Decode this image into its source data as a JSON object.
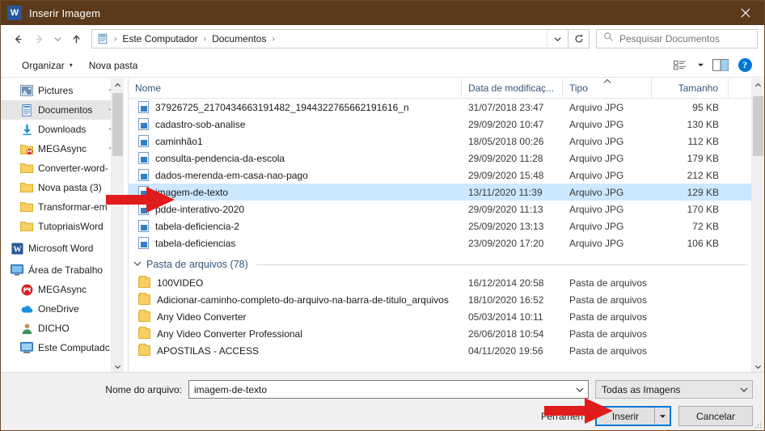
{
  "window": {
    "title": "Inserir Imagem",
    "app_icon": "word-icon",
    "close_label": "✕",
    "accent_brown": "#5b3a1c",
    "accent_blue": "#0078d7"
  },
  "addressbar": {
    "back_icon": "back-arrow-icon",
    "forward_icon": "forward-arrow-icon",
    "recent_icon": "chevron-down-icon",
    "up_icon": "up-arrow-icon",
    "crumb_icon": "documents-icon",
    "crumbs": [
      "Este Computador",
      "Documentos"
    ],
    "separator": "›",
    "dropdown_icon": "chevron-down-icon",
    "refresh_icon": "refresh-icon",
    "search_icon": "search-icon",
    "search_placeholder": "Pesquisar Documentos"
  },
  "commandbar": {
    "organize_label": "Organizar",
    "organize_caret": "▾",
    "new_folder_label": "Nova pasta",
    "view_icon": "view-layout-icon",
    "view_caret": "▾",
    "preview_icon": "preview-pane-icon",
    "help_icon": "help-icon",
    "help_label": "?"
  },
  "navpane": {
    "items": [
      {
        "label": "Pictures",
        "icon": "pictures-icon",
        "pinned": true,
        "selected": false,
        "indent": "child"
      },
      {
        "label": "Documentos",
        "icon": "documents-icon",
        "pinned": true,
        "selected": true,
        "indent": "child"
      },
      {
        "label": "Downloads",
        "icon": "downloads-icon",
        "pinned": true,
        "selected": false,
        "indent": "child"
      },
      {
        "label": "MEGAsync",
        "icon": "megasync-folder-icon",
        "pinned": true,
        "selected": false,
        "indent": "child"
      },
      {
        "label": "Converter-word-",
        "icon": "folder-icon",
        "pinned": false,
        "selected": false,
        "indent": "child"
      },
      {
        "label": "Nova pasta (3)",
        "icon": "folder-icon",
        "pinned": false,
        "selected": false,
        "indent": "child"
      },
      {
        "label": "Transformar-em",
        "icon": "folder-icon",
        "pinned": false,
        "selected": false,
        "indent": "child"
      },
      {
        "label": "TutopriaisWord",
        "icon": "folder-icon",
        "pinned": false,
        "selected": false,
        "indent": "child"
      }
    ],
    "items2": [
      {
        "label": "Microsoft Word",
        "icon": "word-icon",
        "pinned": false,
        "selected": false,
        "indent": "root"
      }
    ],
    "items3": [
      {
        "label": "Área de Trabalho",
        "icon": "desktop-icon",
        "pinned": false,
        "selected": false,
        "indent": "root"
      },
      {
        "label": "MEGAsync",
        "icon": "megasync-icon",
        "pinned": false,
        "selected": false,
        "indent": "child"
      },
      {
        "label": "OneDrive",
        "icon": "onedrive-icon",
        "pinned": false,
        "selected": false,
        "indent": "child"
      },
      {
        "label": "DICHO",
        "icon": "user-icon",
        "pinned": false,
        "selected": false,
        "indent": "child"
      },
      {
        "label": "Este Computadc",
        "icon": "this-pc-icon",
        "pinned": false,
        "selected": false,
        "indent": "child"
      }
    ]
  },
  "filelist": {
    "columns": [
      {
        "key": "nome",
        "label": "Nome"
      },
      {
        "key": "data",
        "label": "Data de modificaç..."
      },
      {
        "key": "tipo",
        "label": "Tipo",
        "sorted": true
      },
      {
        "key": "tam",
        "label": "Tamanho"
      }
    ],
    "files": [
      {
        "nome": "37926725_2170434663191482_1944322765662191616_n",
        "data": "31/07/2018 23:47",
        "tipo": "Arquivo JPG",
        "tam": "95 KB",
        "icon": "jpg-file-icon",
        "selected": false
      },
      {
        "nome": "cadastro-sob-analise",
        "data": "29/09/2020 10:47",
        "tipo": "Arquivo JPG",
        "tam": "130 KB",
        "icon": "jpg-file-icon",
        "selected": false
      },
      {
        "nome": "caminhão1",
        "data": "18/05/2018 00:26",
        "tipo": "Arquivo JPG",
        "tam": "112 KB",
        "icon": "jpg-file-icon",
        "selected": false
      },
      {
        "nome": "consulta-pendencia-da-escola",
        "data": "29/09/2020 11:28",
        "tipo": "Arquivo JPG",
        "tam": "179 KB",
        "icon": "jpg-file-icon",
        "selected": false
      },
      {
        "nome": "dados-merenda-em-casa-nao-pago",
        "data": "29/09/2020 15:48",
        "tipo": "Arquivo JPG",
        "tam": "212 KB",
        "icon": "jpg-file-icon",
        "selected": false
      },
      {
        "nome": "imagem-de-texto",
        "data": "13/11/2020 11:39",
        "tipo": "Arquivo JPG",
        "tam": "129 KB",
        "icon": "jpg-file-icon",
        "selected": true
      },
      {
        "nome": "pdde-interativo-2020",
        "data": "29/09/2020 11:13",
        "tipo": "Arquivo JPG",
        "tam": "170 KB",
        "icon": "jpg-file-icon",
        "selected": false
      },
      {
        "nome": "tabela-deficiencia-2",
        "data": "25/09/2020 13:13",
        "tipo": "Arquivo JPG",
        "tam": "72 KB",
        "icon": "jpg-file-icon",
        "selected": false
      },
      {
        "nome": "tabela-deficiencias",
        "data": "23/09/2020 17:20",
        "tipo": "Arquivo JPG",
        "tam": "106 KB",
        "icon": "jpg-file-icon",
        "selected": false
      }
    ],
    "group": {
      "caret": "˅",
      "label": "Pasta de arquivos (78)"
    },
    "folders": [
      {
        "nome": "100VIDEO",
        "data": "16/12/2014 20:58",
        "tipo": "Pasta de arquivos",
        "tam": "",
        "icon": "folder-icon",
        "selected": false
      },
      {
        "nome": "Adicionar-caminho-completo-do-arquivo-na-barra-de-titulo_arquivos",
        "data": "18/10/2020 16:52",
        "tipo": "Pasta de arquivos",
        "tam": "",
        "icon": "folder-icon",
        "selected": false
      },
      {
        "nome": "Any Video Converter",
        "data": "05/03/2014 10:11",
        "tipo": "Pasta de arquivos",
        "tam": "",
        "icon": "folder-icon",
        "selected": false
      },
      {
        "nome": "Any Video Converter Professional",
        "data": "26/06/2018 10:54",
        "tipo": "Pasta de arquivos",
        "tam": "",
        "icon": "folder-icon",
        "selected": false
      },
      {
        "nome": "APOSTILAS - ACCESS",
        "data": "04/11/2020 19:56",
        "tipo": "Pasta de arquivos",
        "tam": "",
        "icon": "folder-icon",
        "selected": false
      }
    ]
  },
  "bottom": {
    "filename_label": "Nome do arquivo:",
    "filename_value": "imagem-de-texto",
    "filename_caret": "˅",
    "filter_value": "Todas as Imagens",
    "filter_caret": "˅",
    "tools_label": "Ferramen",
    "insert_label": "Inserir",
    "insert_caret": "▾",
    "cancel_label": "Cancelar"
  },
  "annotations": {
    "arrow_color": "#e01b1b",
    "arrow1_target": "nova-pasta-3-sidebar-row",
    "arrow2_target": "insert-button"
  }
}
